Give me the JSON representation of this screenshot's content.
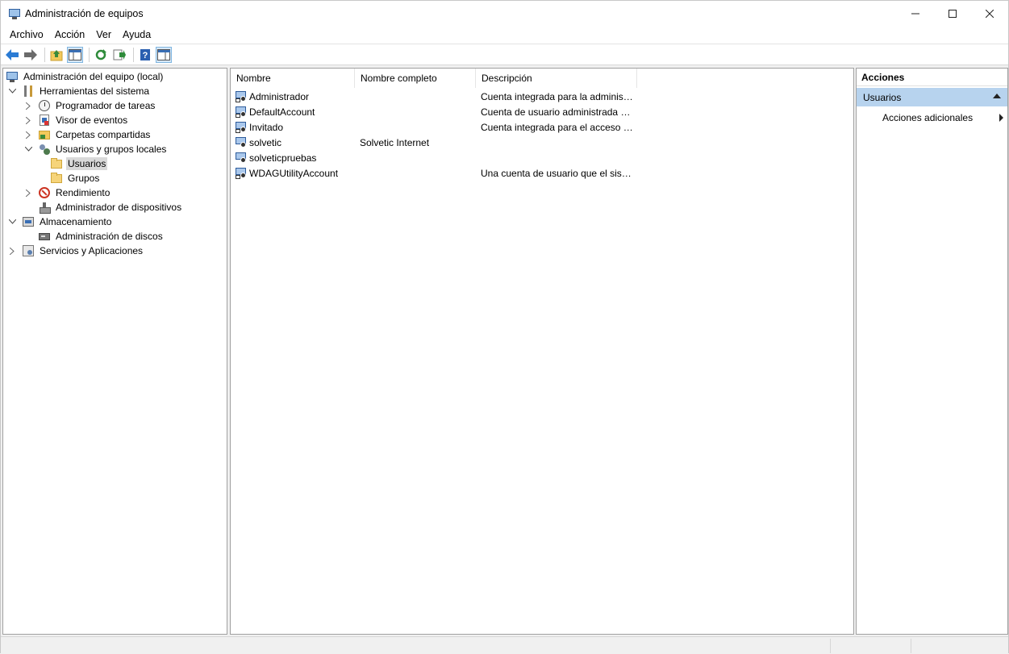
{
  "window": {
    "title": "Administración de equipos",
    "controls": {
      "minimize": "—",
      "maximize": "☐",
      "close": "✕"
    }
  },
  "menu": [
    {
      "label": "Archivo"
    },
    {
      "label": "Acción"
    },
    {
      "label": "Ver"
    },
    {
      "label": "Ayuda"
    }
  ],
  "toolbar": [
    {
      "icon": "back-arrow-icon"
    },
    {
      "icon": "forward-arrow-icon"
    },
    {
      "icon": "up-folder-icon"
    },
    {
      "icon": "show-hide-tree-icon",
      "pressed": true
    },
    {
      "icon": "refresh-icon"
    },
    {
      "icon": "export-list-icon"
    },
    {
      "icon": "help-icon"
    },
    {
      "icon": "show-hide-action-pane-icon",
      "pressed": true
    }
  ],
  "tree": [
    {
      "label": "Administración del equipo (local)",
      "icon": "computer-management-icon",
      "expander": ""
    },
    {
      "label": "Herramientas del sistema",
      "icon": "system-tools-icon",
      "expander": "v"
    },
    {
      "label": "Programador de tareas",
      "icon": "task-scheduler-icon",
      "expander": ">"
    },
    {
      "label": "Visor de eventos",
      "icon": "event-viewer-icon",
      "expander": ">"
    },
    {
      "label": "Carpetas compartidas",
      "icon": "shared-folders-icon",
      "expander": ">"
    },
    {
      "label": "Usuarios y grupos locales",
      "icon": "local-users-groups-icon",
      "expander": "v"
    },
    {
      "label": "Usuarios",
      "icon": "folder-icon",
      "expander": "",
      "selected": true
    },
    {
      "label": "Grupos",
      "icon": "folder-icon",
      "expander": ""
    },
    {
      "label": "Rendimiento",
      "icon": "performance-icon",
      "expander": ">"
    },
    {
      "label": "Administrador de dispositivos",
      "icon": "device-manager-icon",
      "expander": ""
    },
    {
      "label": "Almacenamiento",
      "icon": "storage-icon",
      "expander": "v"
    },
    {
      "label": "Administración de discos",
      "icon": "disk-management-icon",
      "expander": ""
    },
    {
      "label": "Servicios y Aplicaciones",
      "icon": "services-applications-icon",
      "expander": ">"
    }
  ],
  "list": {
    "columns": [
      "Nombre",
      "Nombre completo",
      "Descripción"
    ],
    "rows": [
      {
        "name": "Administrador",
        "full_name": "",
        "description": "Cuenta integrada para la administ..."
      },
      {
        "name": "DefaultAccount",
        "full_name": "",
        "description": "Cuenta de usuario administrada p..."
      },
      {
        "name": "Invitado",
        "full_name": "",
        "description": "Cuenta integrada para el acceso c..."
      },
      {
        "name": "solvetic",
        "full_name": "Solvetic Internet",
        "description": ""
      },
      {
        "name": "solveticpruebas",
        "full_name": "",
        "description": ""
      },
      {
        "name": "WDAGUtilityAccount",
        "full_name": "",
        "description": "Una cuenta de usuario que el siste..."
      }
    ]
  },
  "actions": {
    "header": "Acciones",
    "section": "Usuarios",
    "item": "Acciones adicionales"
  },
  "colors": {
    "selection": "#d9d9d9",
    "actions_section": "#b7d3ee",
    "toolbar_pressed": "#d6e8f7"
  }
}
